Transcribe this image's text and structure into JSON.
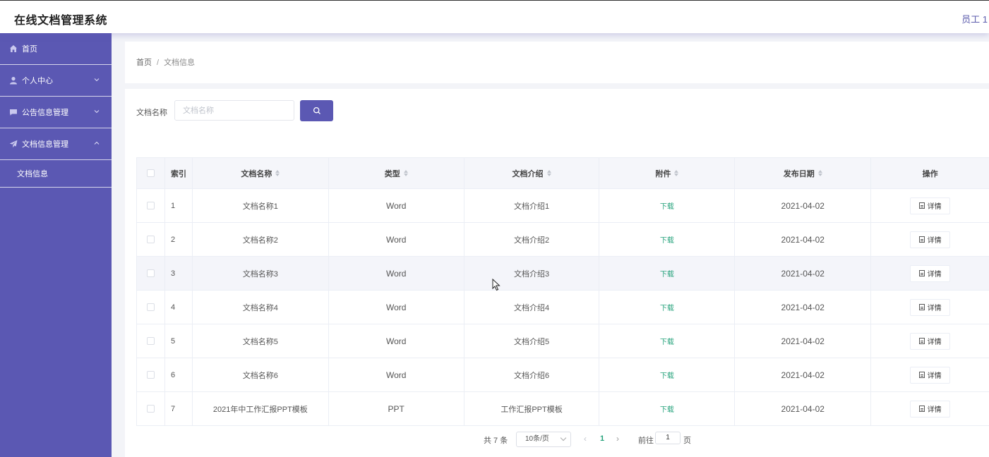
{
  "header": {
    "title": "在线文档管理系统",
    "user": "员工 1"
  },
  "sidebar": {
    "items": [
      {
        "label": "首页",
        "icon": "home-icon",
        "chevron": ""
      },
      {
        "label": "个人中心",
        "icon": "user-icon",
        "chevron": "down"
      },
      {
        "label": "公告信息管理",
        "icon": "message-icon",
        "chevron": "down"
      },
      {
        "label": "文档信息管理",
        "icon": "send-icon",
        "chevron": "up"
      }
    ],
    "subitems": [
      {
        "label": "文档信息"
      }
    ]
  },
  "breadcrumb": {
    "home": "首页",
    "separator": "/",
    "current": "文档信息"
  },
  "search": {
    "label": "文档名称",
    "placeholder": "文档名称",
    "button_icon": "search-icon"
  },
  "table": {
    "columns": [
      "索引",
      "文档名称",
      "类型",
      "文档介绍",
      "附件",
      "发布日期",
      "操作"
    ],
    "rows": [
      {
        "index": "1",
        "name": "文档名称1",
        "type": "Word",
        "intro": "文档介绍1",
        "attachment": "下载",
        "date": "2021-04-02",
        "action": "详情"
      },
      {
        "index": "2",
        "name": "文档名称2",
        "type": "Word",
        "intro": "文档介绍2",
        "attachment": "下载",
        "date": "2021-04-02",
        "action": "详情"
      },
      {
        "index": "3",
        "name": "文档名称3",
        "type": "Word",
        "intro": "文档介绍3",
        "attachment": "下载",
        "date": "2021-04-02",
        "action": "详情"
      },
      {
        "index": "4",
        "name": "文档名称4",
        "type": "Word",
        "intro": "文档介绍4",
        "attachment": "下载",
        "date": "2021-04-02",
        "action": "详情"
      },
      {
        "index": "5",
        "name": "文档名称5",
        "type": "Word",
        "intro": "文档介绍5",
        "attachment": "下载",
        "date": "2021-04-02",
        "action": "详情"
      },
      {
        "index": "6",
        "name": "文档名称6",
        "type": "Word",
        "intro": "文档介绍6",
        "attachment": "下载",
        "date": "2021-04-02",
        "action": "详情"
      },
      {
        "index": "7",
        "name": "2021年中工作汇报PPT模板",
        "type": "PPT",
        "intro": "工作汇报PPT模板",
        "attachment": "下载",
        "date": "2021-04-02",
        "action": "详情"
      }
    ]
  },
  "pagination": {
    "total": "共 7 条",
    "page_size": "10条/页",
    "current_page": "1",
    "goto_label": "前往",
    "goto_value": "1",
    "goto_unit": "页"
  },
  "colors": {
    "primary": "#5b58b3",
    "link": "#27a37c",
    "background": "#f3f4f8"
  }
}
